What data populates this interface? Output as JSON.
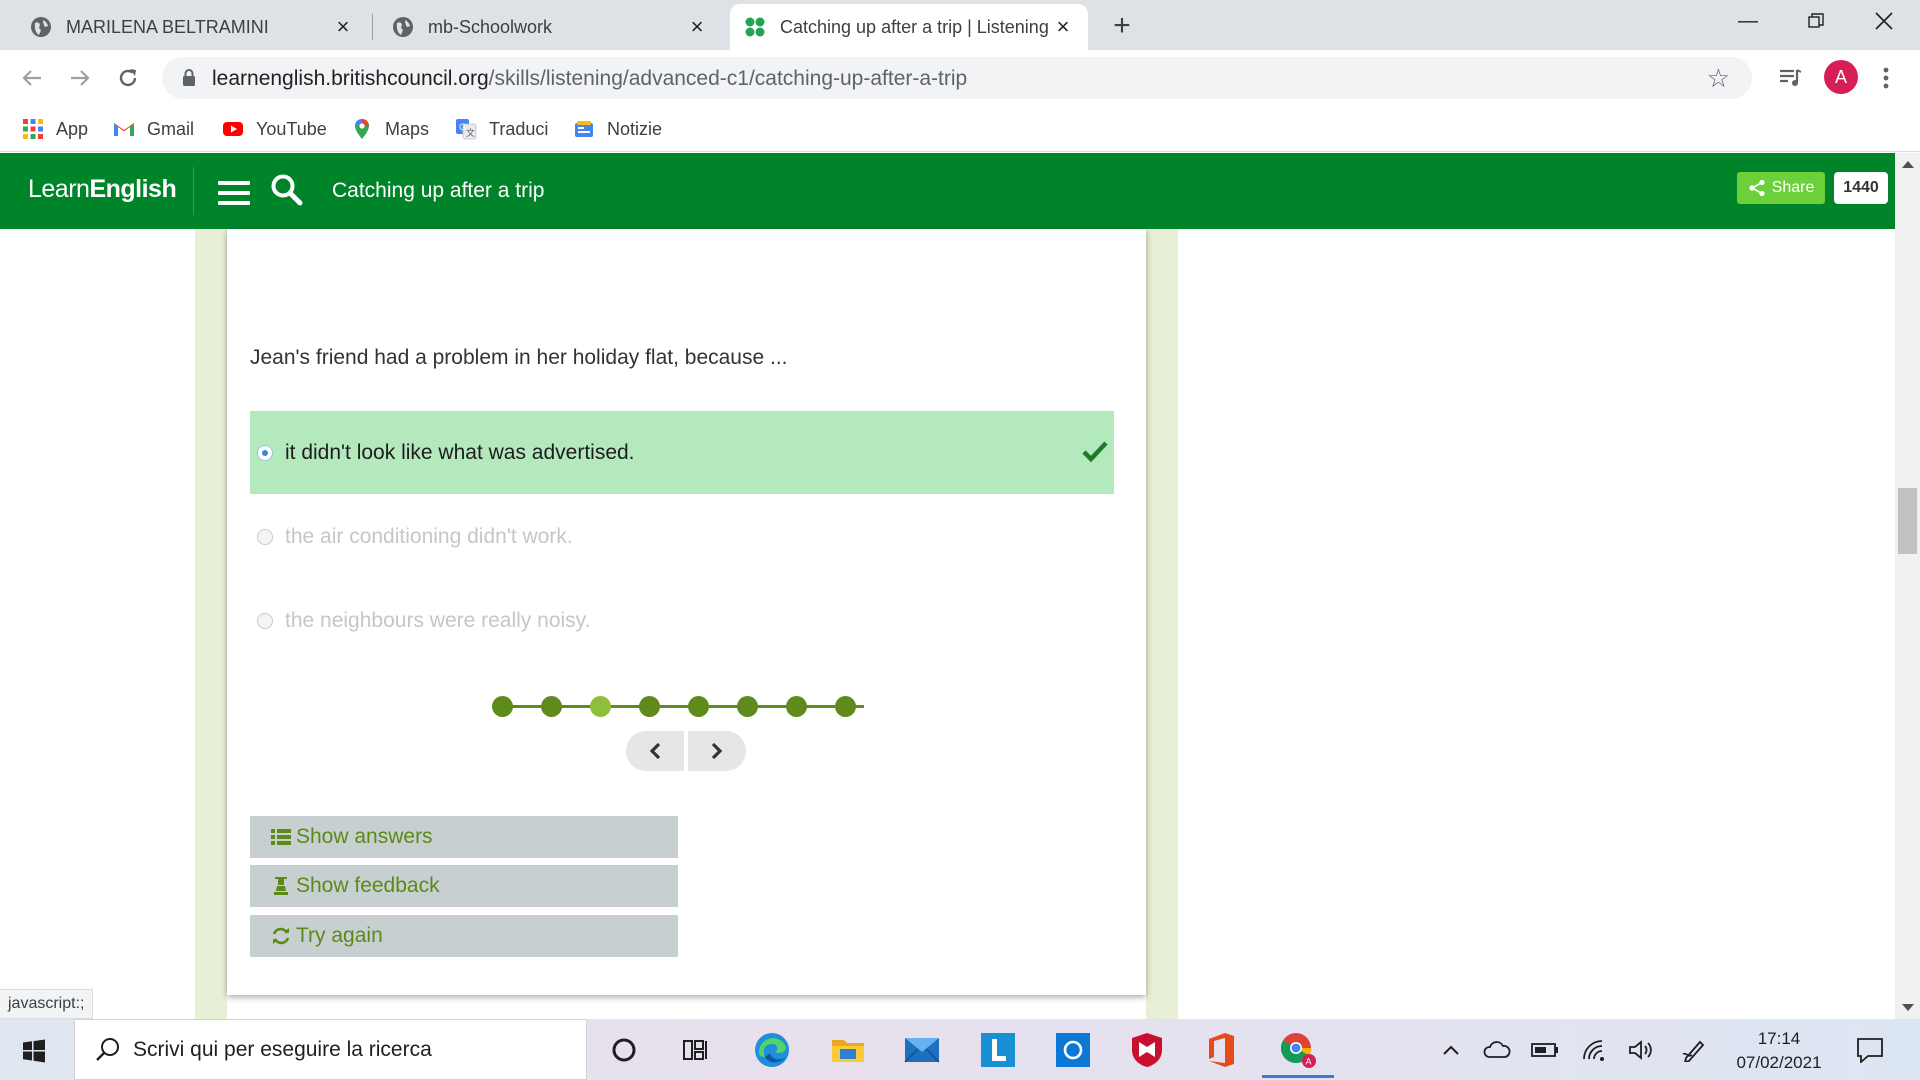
{
  "browser": {
    "tabs": [
      {
        "label": "MARILENA BELTRAMINI",
        "active": false
      },
      {
        "label": "mb-Schoolwork",
        "active": false
      },
      {
        "label": "Catching up after a trip | Listening",
        "active": true
      }
    ],
    "url_host": "learnenglish.britishcouncil.org",
    "url_path": "/skills/listening/advanced-c1/catching-up-after-a-trip",
    "profile_initial": "A",
    "bookmarks": [
      {
        "label": "App",
        "icon": "apps-grid-icon"
      },
      {
        "label": "Gmail",
        "icon": "gmail-icon"
      },
      {
        "label": "YouTube",
        "icon": "youtube-icon"
      },
      {
        "label": "Maps",
        "icon": "maps-pin-icon"
      },
      {
        "label": "Traduci",
        "icon": "translate-icon"
      },
      {
        "label": "Notizie",
        "icon": "news-icon"
      }
    ],
    "status_text": "javascript:;"
  },
  "site": {
    "logo_light": "Learn",
    "logo_bold": "English",
    "page_title": "Catching up after a trip",
    "share_label": "Share",
    "share_count": "1440",
    "brand_color": "#00842a"
  },
  "quiz": {
    "question": "Jean's friend had a problem in her holiday flat, because ...",
    "options": [
      {
        "text": "it didn't look like what was advertised.",
        "state": "correct"
      },
      {
        "text": "the air conditioning didn't work.",
        "state": "disabled"
      },
      {
        "text": "the neighbours were really noisy.",
        "state": "disabled"
      }
    ],
    "progress": {
      "total": 8,
      "current": 3
    },
    "buttons": {
      "show_answers": "Show answers",
      "show_feedback": "Show feedback",
      "try_again": "Try again"
    }
  },
  "taskbar": {
    "search_placeholder": "Scrivi qui per eseguire la ricerca",
    "time": "17:14",
    "date": "07/02/2021"
  }
}
